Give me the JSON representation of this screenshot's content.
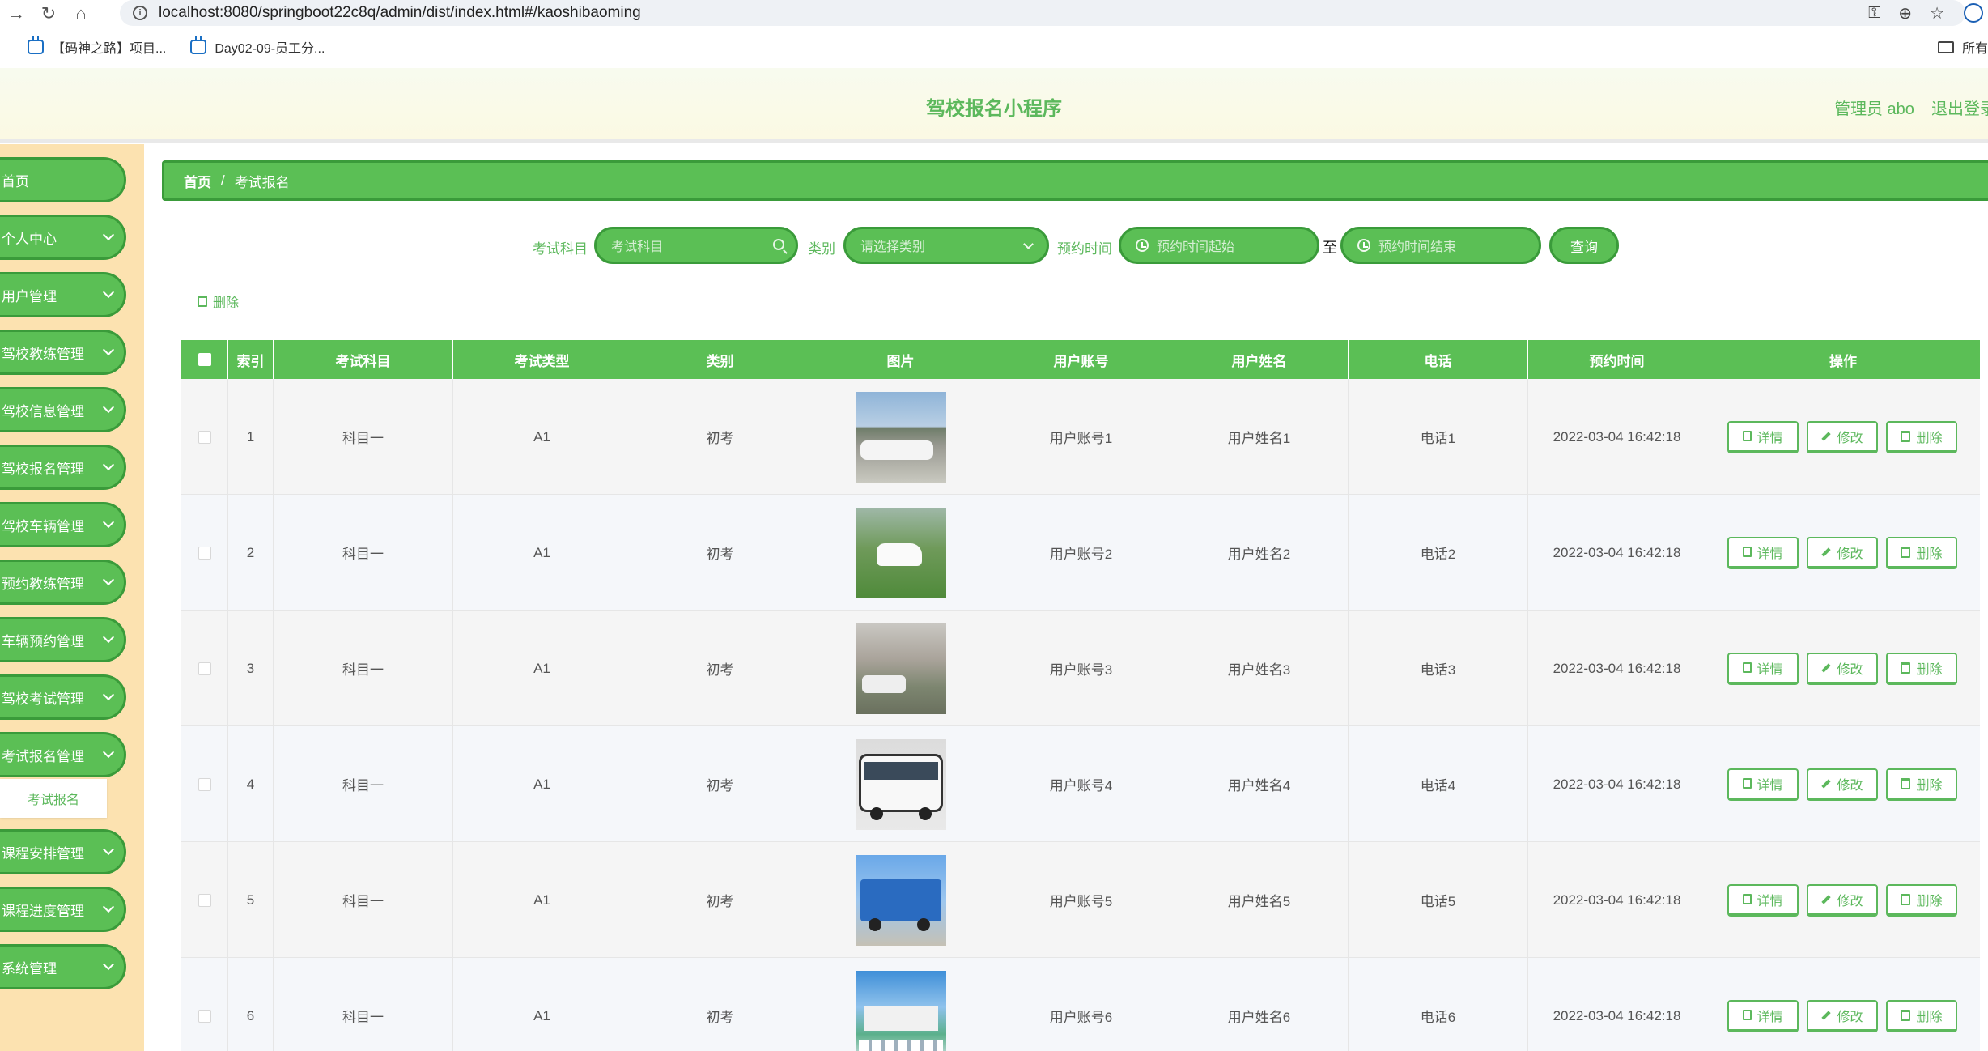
{
  "browser": {
    "url": "localhost:8080/springboot22c8q/admin/dist/index.html#/kaoshibaoming",
    "bookmarks": [
      "【码神之路】项目...",
      "Day02-09-员工分..."
    ],
    "bookmarks_folder": "所有"
  },
  "header": {
    "title": "驾校报名小程序",
    "user": "管理员 abo",
    "logout": "退出登录"
  },
  "sidebar": {
    "items": [
      {
        "label": "首页",
        "expandable": false
      },
      {
        "label": "个人中心",
        "expandable": true
      },
      {
        "label": "用户管理",
        "expandable": true
      },
      {
        "label": "驾校教练管理",
        "expandable": true
      },
      {
        "label": "驾校信息管理",
        "expandable": true
      },
      {
        "label": "驾校报名管理",
        "expandable": true
      },
      {
        "label": "驾校车辆管理",
        "expandable": true
      },
      {
        "label": "预约教练管理",
        "expandable": true
      },
      {
        "label": "车辆预约管理",
        "expandable": true
      },
      {
        "label": "驾校考试管理",
        "expandable": true
      },
      {
        "label": "考试报名管理",
        "expandable": true
      },
      {
        "label": "课程安排管理",
        "expandable": true
      },
      {
        "label": "课程进度管理",
        "expandable": true
      },
      {
        "label": "系统管理",
        "expandable": true
      }
    ],
    "active_submenu": "考试报名"
  },
  "breadcrumb": {
    "home": "首页",
    "separator": "/",
    "current": "考试报名"
  },
  "search": {
    "subject_label": "考试科目",
    "subject_placeholder": "考试科目",
    "category_label": "类别",
    "category_placeholder": "请选择类别",
    "time_label": "预约时间",
    "time_start_placeholder": "预约时间起始",
    "range_separator": "至",
    "time_end_placeholder": "预约时间结束",
    "query_button": "查询"
  },
  "actions": {
    "batch_delete": "删除"
  },
  "table": {
    "columns": [
      "索引",
      "考试科目",
      "考试类型",
      "类别",
      "图片",
      "用户账号",
      "用户姓名",
      "电话",
      "预约时间",
      "操作"
    ],
    "row_actions": {
      "detail": "详情",
      "edit": "修改",
      "delete": "删除"
    },
    "rows": [
      {
        "index": "1",
        "subject": "科目一",
        "type": "A1",
        "category": "初考",
        "image": "cars-parked-row",
        "account": "用户账号1",
        "name": "用户姓名1",
        "phone": "电话1",
        "time": "2022-03-04 16:42:18"
      },
      {
        "index": "2",
        "subject": "科目一",
        "type": "A1",
        "category": "初考",
        "image": "white-car-on-grass",
        "account": "用户账号2",
        "name": "用户姓名2",
        "phone": "电话2",
        "time": "2022-03-04 16:42:18"
      },
      {
        "index": "3",
        "subject": "科目一",
        "type": "A1",
        "category": "初考",
        "image": "cars-under-trees",
        "account": "用户账号3",
        "name": "用户姓名3",
        "phone": "电话3",
        "time": "2022-03-04 16:42:18"
      },
      {
        "index": "4",
        "subject": "科目一",
        "type": "A1",
        "category": "初考",
        "image": "white-bus",
        "account": "用户账号4",
        "name": "用户姓名4",
        "phone": "电话4",
        "time": "2022-03-04 16:42:18"
      },
      {
        "index": "5",
        "subject": "科目一",
        "type": "A1",
        "category": "初考",
        "image": "blue-truck",
        "account": "用户账号5",
        "name": "用户姓名5",
        "phone": "电话5",
        "time": "2022-03-04 16:42:18"
      },
      {
        "index": "6",
        "subject": "科目一",
        "type": "A1",
        "category": "初考",
        "image": "driving-school-building",
        "account": "用户账号6",
        "name": "用户姓名6",
        "phone": "电话6",
        "time": "2022-03-04 16:42:18"
      }
    ]
  },
  "colors": {
    "primary_green": "#5bbf55",
    "border_green": "#3a9b3a",
    "text_green": "#5cb85c",
    "sidebar_bg": "#fce2b0"
  }
}
